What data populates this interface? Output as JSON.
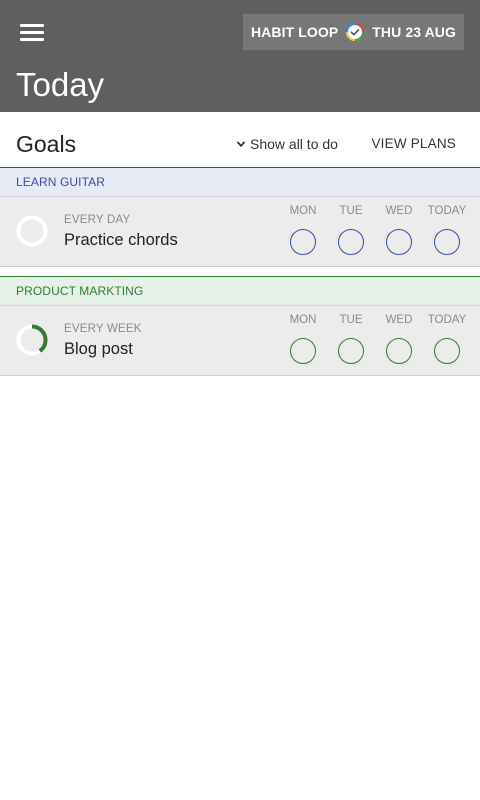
{
  "header": {
    "app_name": "HABIT LOOP",
    "date": "THU 23 AUG",
    "screen_title": "Today",
    "menu_icon": "hamburger-menu-icon",
    "logo_icon": "habit-loop-logo-icon"
  },
  "goals": {
    "title": "Goals",
    "show_all_label": "Show all to do",
    "view_plans_label": "VIEW PLANS"
  },
  "sections": [
    {
      "name": "LEARN GUITAR",
      "accent": "#3b4aa8",
      "band_bg": "#e6ebf6",
      "goal": {
        "frequency": "EVERY DAY",
        "name": "Practice chords",
        "progress": 0.0,
        "days": [
          "MON",
          "TUE",
          "WED",
          "TODAY"
        ]
      }
    },
    {
      "name": "PRODUCT MARKTING",
      "accent": "#2e7d32",
      "band_bg": "#e6f2e8",
      "goal": {
        "frequency": "EVERY WEEK",
        "name": "Blog post",
        "progress": 0.4,
        "days": [
          "MON",
          "TUE",
          "WED",
          "TODAY"
        ]
      }
    }
  ]
}
